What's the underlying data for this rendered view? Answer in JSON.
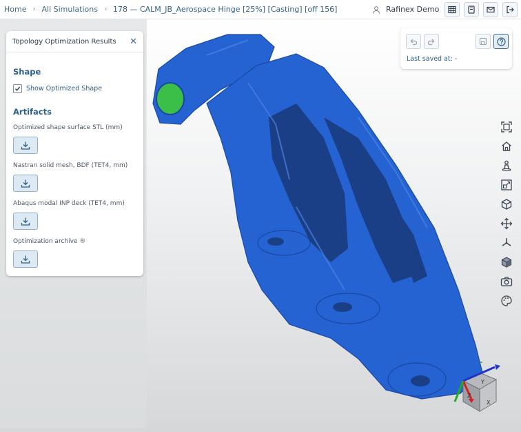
{
  "breadcrumb": {
    "home": "Home",
    "all_simulations": "All Simulations",
    "current": "178 — CALM_JB_Aerospace Hinge [25%] [Casting] [off 156]"
  },
  "user": {
    "name": "Rafinex Demo"
  },
  "header_icons": [
    "table-icon",
    "notebook-icon",
    "mail-icon",
    "logout-icon"
  ],
  "panel": {
    "title": "Topology Optimization Results",
    "shape_heading": "Shape",
    "show_optimized_label": "Show Optimized Shape",
    "show_optimized_checked": true,
    "artifacts_heading": "Artifacts",
    "artifacts": [
      {
        "label": "Optimized shape surface STL (mm)"
      },
      {
        "label": "Nastran solid mesh, BDF (TET4, mm)"
      },
      {
        "label": "Abaqus modal INP deck (TET4, mm)"
      },
      {
        "label": "Optimization archive ®"
      }
    ]
  },
  "save_panel": {
    "last_saved": "Last saved at: -"
  },
  "toolbar_icons": [
    "fit-view-icon",
    "home-icon",
    "person-view-icon",
    "zoom-box-icon",
    "cube-icon",
    "move-icon",
    "axes-icon",
    "shaded-cube-icon",
    "camera-icon",
    "palette-icon"
  ],
  "orientation_cube": {
    "axis_y": "Y",
    "axis_z": "Z",
    "axis_x": "X"
  },
  "colors": {
    "model": "#2463d1",
    "model_shadow": "#1a48a0",
    "support": "#2f9e2f",
    "accent": "#2f5f86"
  }
}
